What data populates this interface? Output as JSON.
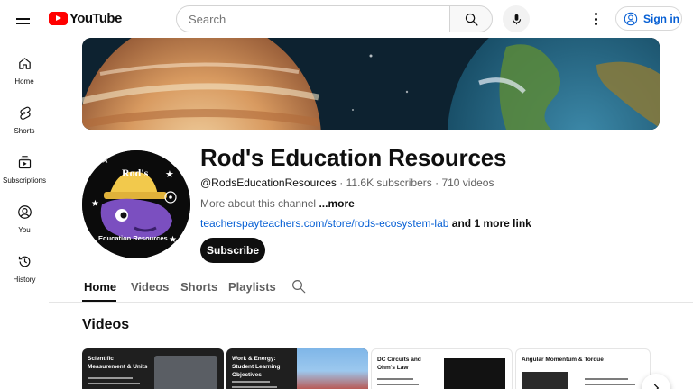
{
  "header": {
    "logo_text": "YouTube",
    "search_placeholder": "Search",
    "sign_in_label": "Sign in"
  },
  "sidebar": {
    "items": [
      {
        "label": "Home",
        "icon": "home-icon"
      },
      {
        "label": "Shorts",
        "icon": "shorts-icon"
      },
      {
        "label": "Subscriptions",
        "icon": "subscriptions-icon"
      },
      {
        "label": "You",
        "icon": "you-icon"
      },
      {
        "label": "History",
        "icon": "history-icon"
      }
    ]
  },
  "channel": {
    "name": "Rod's Education Resources",
    "handle": "@RodsEducationResources",
    "subscribers": "11.6K subscribers",
    "videos_count": "710 videos",
    "separator": " · ",
    "about_text": "More about this channel",
    "about_more": "...more",
    "link": "teacherspayteachers.com/store/rods-ecosystem-lab",
    "more_links": "and 1 more link",
    "subscribe_label": "Subscribe",
    "avatar_text_top": "Rod's",
    "avatar_text_bottom": "Education Resources"
  },
  "tabs": [
    {
      "label": "Home",
      "active": true
    },
    {
      "label": "Videos",
      "active": false
    },
    {
      "label": "Shorts",
      "active": false
    },
    {
      "label": "Playlists",
      "active": false
    }
  ],
  "videos_section": {
    "title": "Videos",
    "cards": [
      {
        "title": "Scientific Measurement & Units",
        "bg": "#1f1f1f",
        "fg": "#ffffff"
      },
      {
        "title": "Work & Energy: Student Learning Objectives",
        "bg": "#1f1f1f",
        "fg": "#ffffff"
      },
      {
        "title": "DC Circuits and Ohm's Law",
        "bg": "#ffffff",
        "fg": "#111111"
      },
      {
        "title": "Angular Momentum & Torque",
        "bg": "#ffffff",
        "fg": "#111111"
      }
    ]
  },
  "colors": {
    "brand_red": "#ff0000",
    "link_blue": "#065fd4",
    "text_primary": "#0f0f0f",
    "text_secondary": "#606060"
  }
}
